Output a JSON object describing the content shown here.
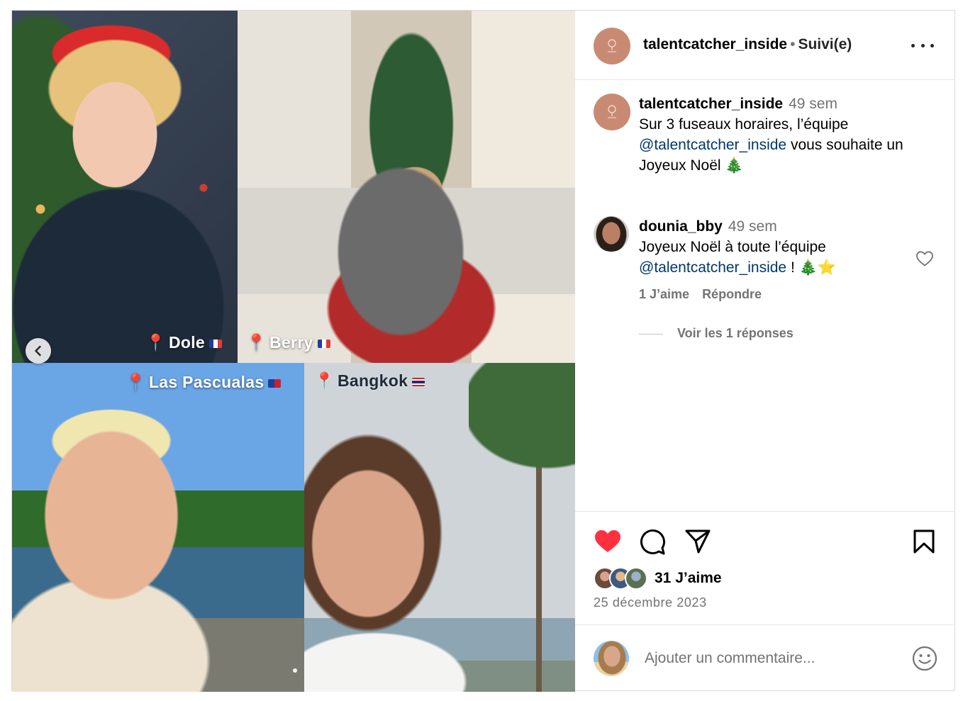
{
  "media": {
    "tiles": [
      {
        "location": "Dole",
        "flag": "flag-fr"
      },
      {
        "location": "Berry",
        "flag": "flag-fr"
      },
      {
        "location": "Las Pascualas",
        "flag": "flag-do"
      },
      {
        "location": "Bangkok",
        "flag": "flag-th"
      }
    ],
    "pin_glyph": "📍"
  },
  "header": {
    "username": "talentcatcher_inside",
    "separator": "•",
    "follow_status": "Suivi(e)"
  },
  "caption": {
    "username": "talentcatcher_inside",
    "time": "49 sem",
    "text_before": "Sur 3 fuseaux horaires, l’équipe ",
    "mention": "@talentcatcher_inside",
    "text_after": " vous souhaite un Joyeux Noël 🎄"
  },
  "comment": {
    "username": "dounia_bby",
    "time": "49 sem",
    "text_before": "Joyeux Noël à toute l’équipe ",
    "mention": "@talentcatcher_inside",
    "text_after": " ! 🎄⭐",
    "likes": "1 J’aime",
    "reply": "Répondre",
    "view_replies": "Voir les 1 réponses"
  },
  "actions": {
    "likes_count": "31 J’aime",
    "date": "25 décembre 2023",
    "like_color": "#ff3040"
  },
  "add_comment": {
    "placeholder": "Ajouter un commentaire..."
  },
  "icons": [
    "chevron-left-icon",
    "more-icon",
    "heart-icon",
    "comment-icon",
    "share-icon",
    "bookmark-icon",
    "emoji-icon",
    "location-pin-icon"
  ]
}
